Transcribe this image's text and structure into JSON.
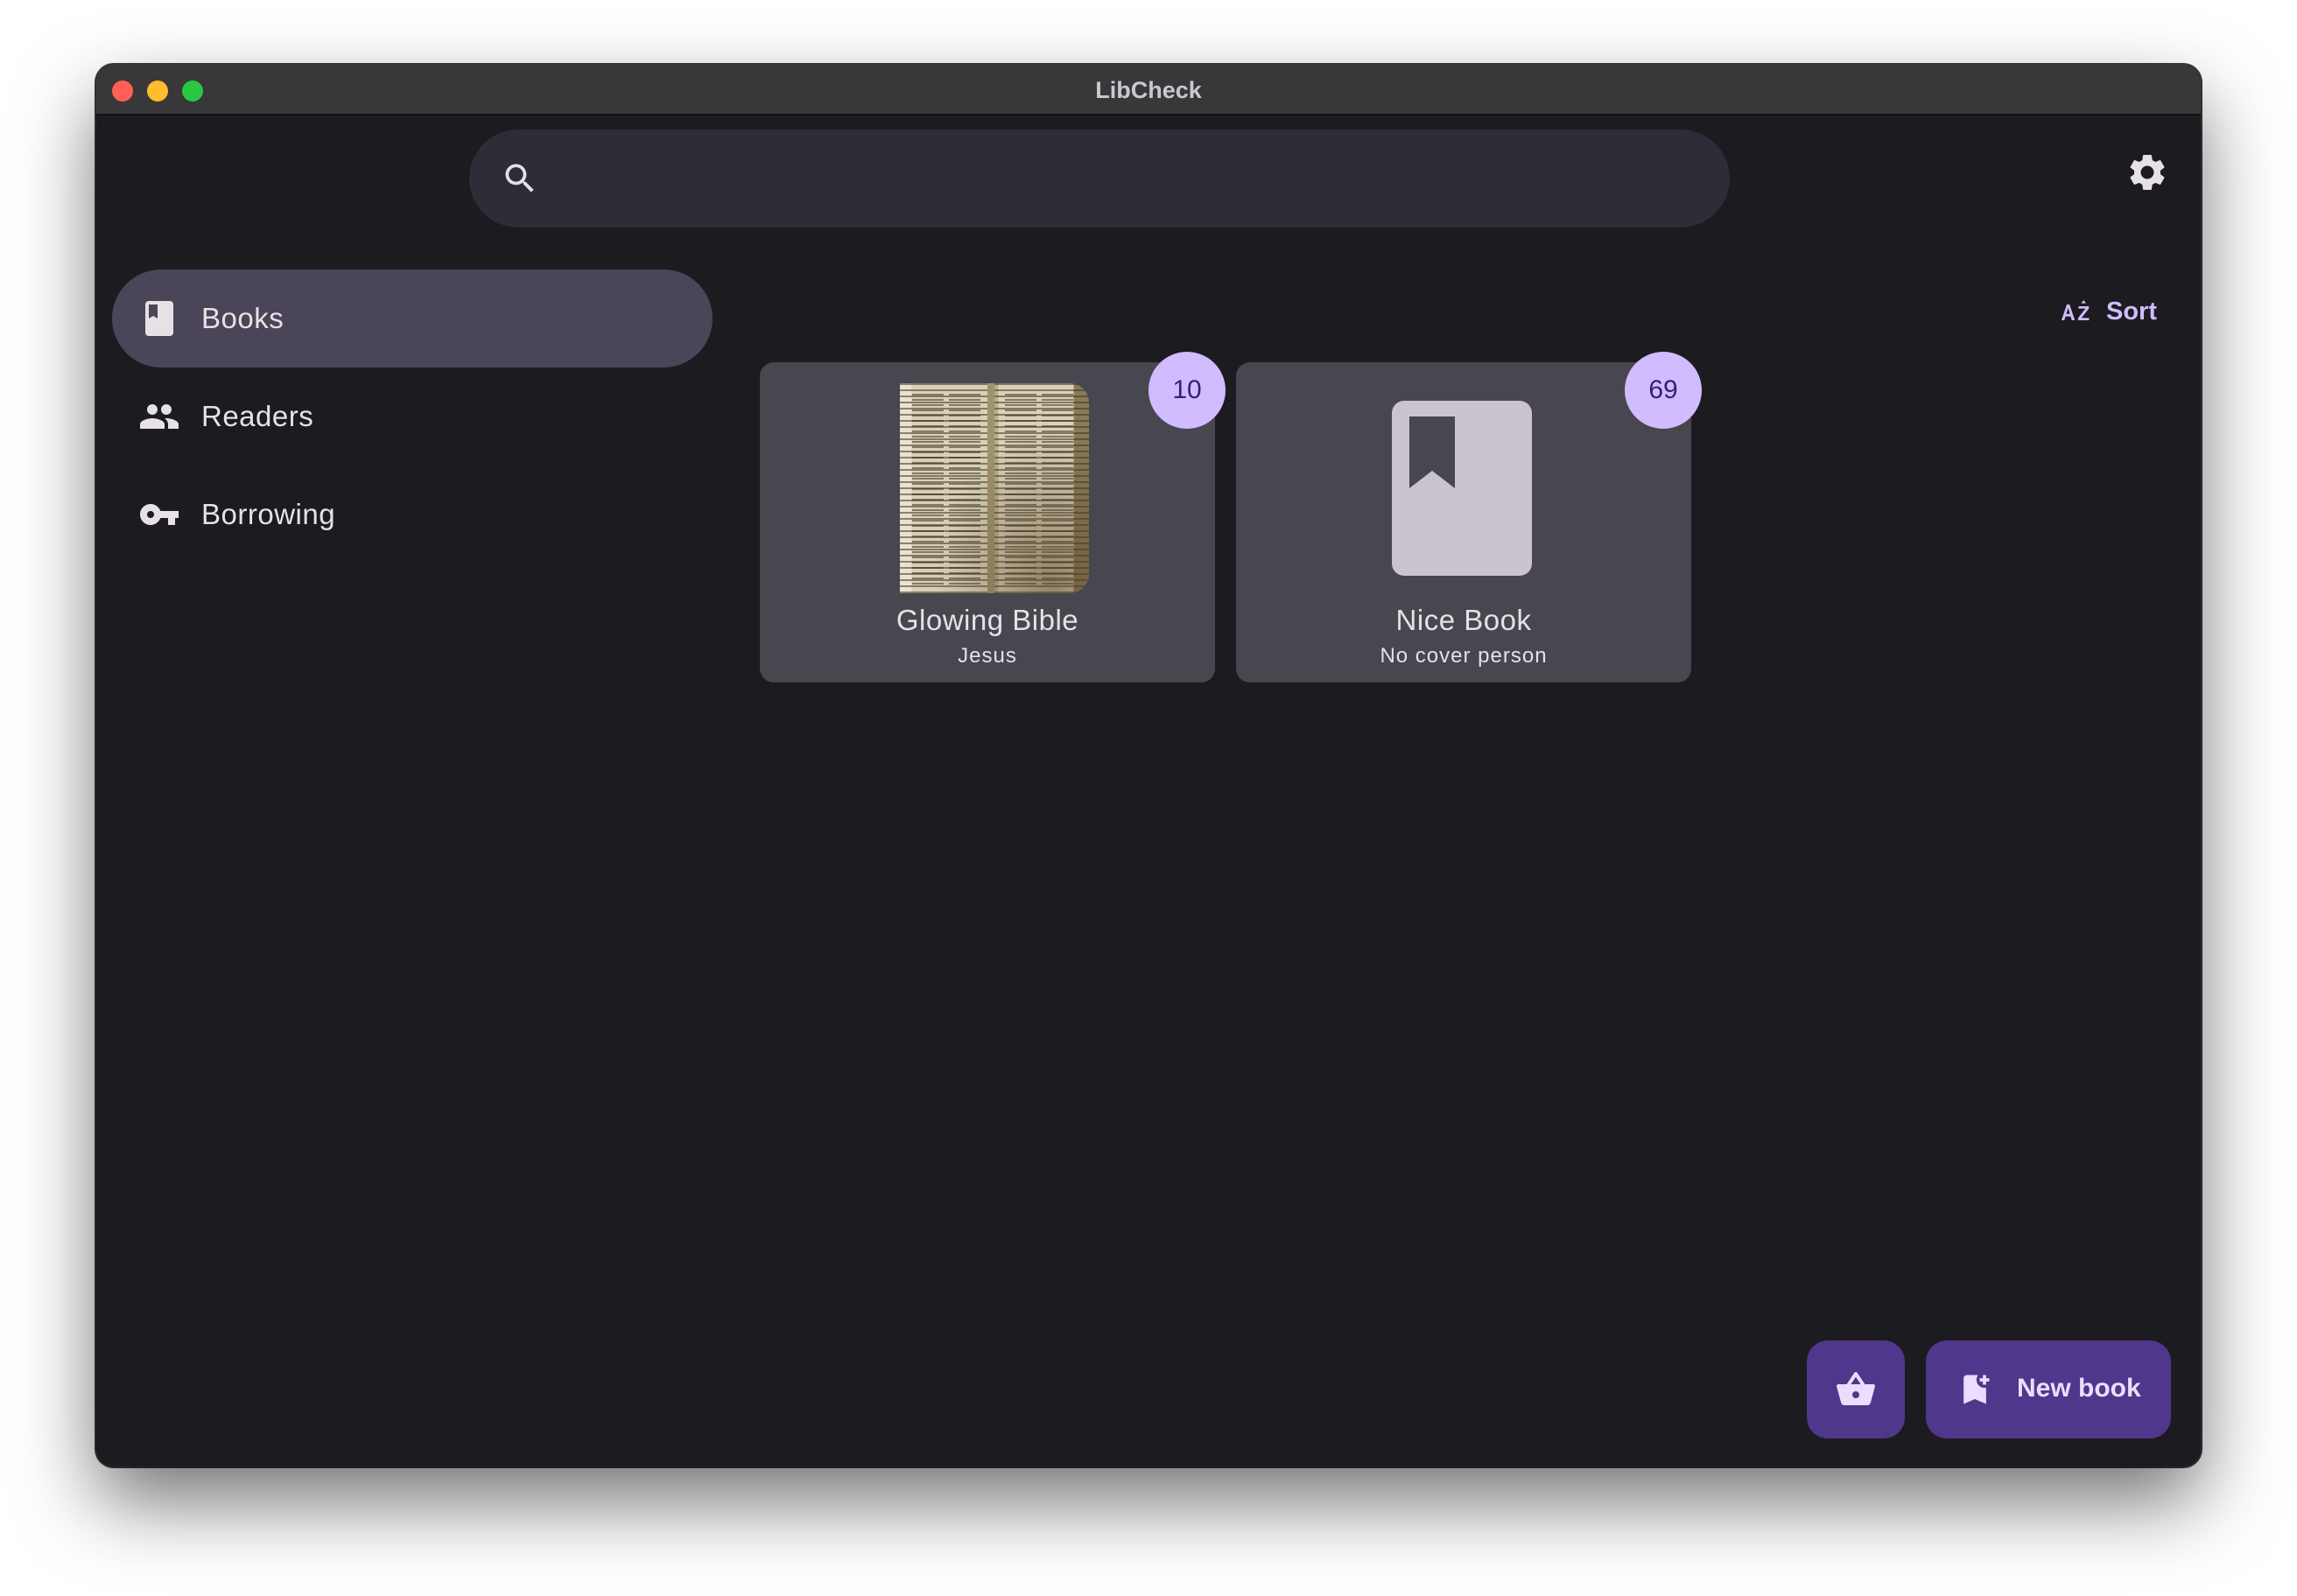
{
  "window": {
    "title": "LibCheck"
  },
  "search": {
    "placeholder": "",
    "value": ""
  },
  "nav": {
    "items": [
      {
        "label": "Books",
        "icon": "book-icon",
        "active": true
      },
      {
        "label": "Readers",
        "icon": "people-icon",
        "active": false
      },
      {
        "label": "Borrowing",
        "icon": "key-icon",
        "active": false
      }
    ]
  },
  "toolbar": {
    "sort_label": "Sort",
    "sort_icon": "sort-az-icon"
  },
  "books": [
    {
      "title": "Glowing Bible",
      "author": "Jesus",
      "count": "10",
      "cover": "manuscript-image"
    },
    {
      "title": "Nice Book",
      "author": "No cover person",
      "count": "69",
      "cover": "bookmark-icon"
    }
  ],
  "fab": {
    "new_book_label": "New book",
    "basket_icon": "basket-icon",
    "new_book_icon": "bookmark-add-icon"
  },
  "colors": {
    "background": "#1c1b20",
    "surface": "#48464f",
    "nav_active": "#4a4558",
    "accent": "#d0bcff",
    "fab": "#4f378b"
  }
}
